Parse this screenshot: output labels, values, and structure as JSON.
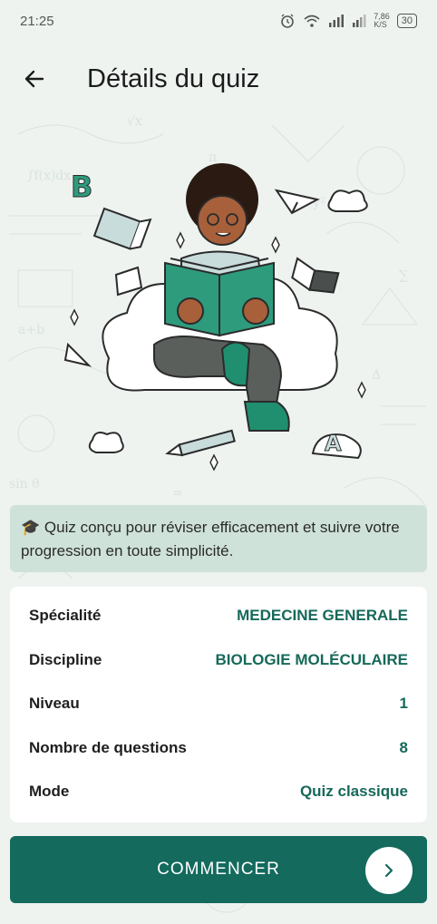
{
  "status_bar": {
    "time": "21:25",
    "network_speed": "7,86",
    "network_unit": "K/S",
    "battery": "30"
  },
  "header": {
    "title": "Détails du quiz",
    "back_icon": "arrow-left-icon"
  },
  "banner": {
    "icon": "🎓",
    "text": "Quiz conçu pour réviser efficacement et suivre votre progression en toute simplicité."
  },
  "details": [
    {
      "label": "Spécialité",
      "value": "MEDECINE GENERALE"
    },
    {
      "label": "Discipline",
      "value": "BIOLOGIE MOLÉCULAIRE"
    },
    {
      "label": "Niveau",
      "value": "1"
    },
    {
      "label": "Nombre de questions",
      "value": "8"
    },
    {
      "label": "Mode",
      "value": "Quiz classique"
    }
  ],
  "start_button": {
    "label": "COMMENCER",
    "icon": "chevron-right-icon"
  },
  "colors": {
    "primary": "#136a5d",
    "accent_text": "#16695a",
    "banner_bg": "#cfe2da",
    "page_bg": "#eef3f0"
  }
}
